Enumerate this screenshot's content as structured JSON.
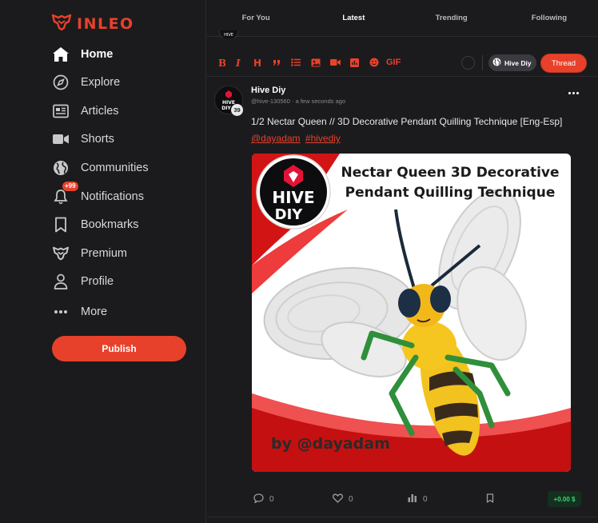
{
  "brand": {
    "logo_text": "INLEO",
    "accent": "#e8412b"
  },
  "sidebar": {
    "items": [
      {
        "label": "Home",
        "icon": "home-icon",
        "active": true
      },
      {
        "label": "Explore",
        "icon": "compass-icon"
      },
      {
        "label": "Articles",
        "icon": "newspaper-icon"
      },
      {
        "label": "Shorts",
        "icon": "video-camera-icon"
      },
      {
        "label": "Communities",
        "icon": "globe-icon"
      },
      {
        "label": "Notifications",
        "icon": "bell-icon",
        "badge": "+99"
      },
      {
        "label": "Bookmarks",
        "icon": "bookmark-icon"
      },
      {
        "label": "Premium",
        "icon": "premium-logo-icon"
      },
      {
        "label": "Profile",
        "icon": "user-icon"
      },
      {
        "label": "More",
        "icon": "more-dots-icon"
      }
    ],
    "publish_label": "Publish"
  },
  "feed_tabs": [
    "For You",
    "Latest",
    "Trending",
    "Following"
  ],
  "active_tab": "Latest",
  "composer": {
    "tools": [
      "bold-icon",
      "italic-icon",
      "heading-icon",
      "quote-icon",
      "list-icon",
      "image-icon",
      "video-icon",
      "poll-icon",
      "emoji-icon",
      "gif-icon"
    ],
    "gif_label": "GIF",
    "account_label": "Hive Diy",
    "thread_label": "Thread"
  },
  "post": {
    "author": "Hive Diy",
    "handle": "@hive-130560",
    "time": "a few seconds ago",
    "reputation": "39",
    "avatar_text": "HIVE DIY",
    "text": "1/2 Nectar Queen // 3D Decorative Pendant Quilling Technique [Eng-Esp]",
    "mention": "@dayadam",
    "hashtag": "#hivediy",
    "image": {
      "title": "Nectar Queen  3D Decorative Pendant Quilling Technique",
      "byline": "by @dayadam",
      "logo_text": "HIVE DIY"
    },
    "comments": "0",
    "likes": "0",
    "views": "0",
    "payout": "+0.00 $"
  }
}
